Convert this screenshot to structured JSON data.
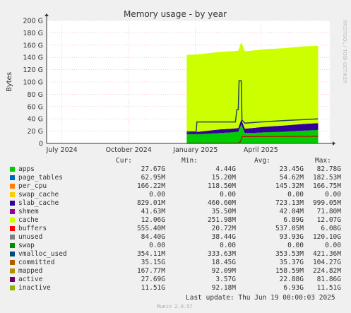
{
  "chart_data": {
    "type": "area",
    "title": "Memory usage - by year",
    "ylabel": "Bytes",
    "ylim": [
      0,
      200
    ],
    "yticks": [
      "0",
      "20 G",
      "40 G",
      "60 G",
      "80 G",
      "100 G",
      "120 G",
      "140 G",
      "160 G",
      "180 G",
      "200 G"
    ],
    "xticks": [
      {
        "t": "2024-07-01",
        "label": "July 2024"
      },
      {
        "t": "2024-10-01",
        "label": "October 2024"
      },
      {
        "t": "2025-01-01",
        "label": "January 2025"
      },
      {
        "t": "2025-04-01",
        "label": "April 2025"
      }
    ],
    "xrange": [
      "2024-06-10",
      "2025-07-05"
    ],
    "grid": true,
    "side_label": "RRDTOOL / TOBI OETIKER",
    "stack_y": {
      "t": [
        "2024-12-20",
        "2025-01-05",
        "2025-01-20",
        "2025-02-05",
        "2025-02-20",
        "2025-03-01",
        "2025-03-05",
        "2025-03-10",
        "2025-03-20",
        "2025-04-05",
        "2025-05-01",
        "2025-06-01",
        "2025-06-19"
      ],
      "apps": [
        14,
        14,
        15,
        16,
        17,
        18,
        30,
        16,
        16,
        17,
        18,
        20,
        21
      ],
      "shmem": [
        1,
        1,
        1,
        1,
        1,
        1,
        1,
        1,
        1,
        1,
        1,
        1,
        1
      ],
      "cache": [
        3,
        4,
        5,
        6,
        6,
        6,
        8,
        7,
        8,
        9,
        10,
        11,
        11
      ],
      "unused": [
        126,
        126,
        126,
        126,
        126,
        126,
        126,
        126,
        126,
        126,
        126,
        126,
        126
      ]
    },
    "committed_line": {
      "t": [
        "2024-12-20",
        "2025-01-02",
        "2025-01-03",
        "2025-02-25",
        "2025-02-27",
        "2025-03-01",
        "2025-03-02",
        "2025-03-05",
        "2025-03-06",
        "2025-03-10",
        "2025-04-01",
        "2025-05-01",
        "2025-06-19"
      ],
      "v": [
        19,
        19,
        35,
        35,
        55,
        55,
        102,
        102,
        38,
        33,
        35,
        37,
        40
      ]
    },
    "inactive_line": {
      "t": [
        "2024-12-20",
        "2025-03-01",
        "2025-03-04",
        "2025-03-06",
        "2025-06-19"
      ],
      "v": [
        0.5,
        0.5,
        3,
        11,
        11.5
      ]
    },
    "series_colors": {
      "apps": "#00cc00",
      "shmem": "#00aa00",
      "cache": "#330099",
      "unused": "#ccff00",
      "committed": "#23465d",
      "inactive": "#cc0000",
      "active": "#c08000",
      "mapped": "#c05000"
    }
  },
  "legend": {
    "headers": {
      "cur": "Cur:",
      "min": "Min:",
      "avg": "Avg:",
      "max": "Max:"
    },
    "rows": [
      {
        "name": "apps",
        "color": "#00cc00",
        "cur": "27.67G",
        "min": "4.44G",
        "avg": "23.45G",
        "max": "82.78G"
      },
      {
        "name": "page_tables",
        "color": "#0066b3",
        "cur": "62.95M",
        "min": "15.20M",
        "avg": "54.62M",
        "max": "182.53M"
      },
      {
        "name": "per_cpu",
        "color": "#ff8000",
        "cur": "166.22M",
        "min": "118.50M",
        "avg": "145.32M",
        "max": "166.75M"
      },
      {
        "name": "swap_cache",
        "color": "#ffcc00",
        "cur": "0.00",
        "min": "0.00",
        "avg": "0.00",
        "max": "0.00"
      },
      {
        "name": "slab_cache",
        "color": "#330099",
        "cur": "829.01M",
        "min": "460.60M",
        "avg": "723.13M",
        "max": "999.05M"
      },
      {
        "name": "shmem",
        "color": "#990099",
        "cur": "41.63M",
        "min": "35.50M",
        "avg": "42.04M",
        "max": "71.80M"
      },
      {
        "name": "cache",
        "color": "#ccff00",
        "cur": "12.06G",
        "min": "251.98M",
        "avg": "6.89G",
        "max": "12.07G"
      },
      {
        "name": "buffers",
        "color": "#ff0000",
        "cur": "555.40M",
        "min": "20.72M",
        "avg": "537.05M",
        "max": "6.08G"
      },
      {
        "name": "unused",
        "color": "#808080",
        "cur": "84.40G",
        "min": "38.44G",
        "avg": "93.93G",
        "max": "120.10G"
      },
      {
        "name": "swap",
        "color": "#008f00",
        "cur": "0.00",
        "min": "0.00",
        "avg": "0.00",
        "max": "0.00"
      },
      {
        "name": "vmalloc_used",
        "color": "#00487d",
        "cur": "354.11M",
        "min": "333.63M",
        "avg": "353.53M",
        "max": "421.36M"
      },
      {
        "name": "committed",
        "color": "#b35a00",
        "cur": "35.15G",
        "min": "18.45G",
        "avg": "35.37G",
        "max": "104.27G"
      },
      {
        "name": "mapped",
        "color": "#b38f00",
        "cur": "167.77M",
        "min": "92.09M",
        "avg": "158.59M",
        "max": "224.82M"
      },
      {
        "name": "active",
        "color": "#6b006b",
        "cur": "27.69G",
        "min": "3.57G",
        "avg": "22.88G",
        "max": "81.86G"
      },
      {
        "name": "inactive",
        "color": "#8fb300",
        "cur": "11.51G",
        "min": "92.18M",
        "avg": "6.93G",
        "max": "11.51G"
      }
    ]
  },
  "footer": {
    "last_update": "Last update: Thu Jun 19 00:00:03 2025",
    "munin": "Munin 2.0.57"
  }
}
